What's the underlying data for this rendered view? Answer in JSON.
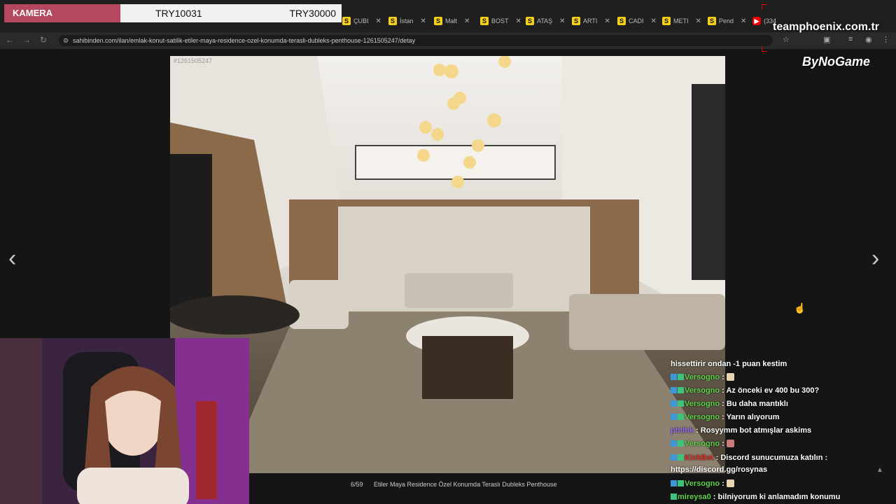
{
  "overlay": {
    "kamera_label": "KAMERA",
    "try_current": "TRY10031",
    "try_target": "TRY30000",
    "brand_url": "teamphoenix.com.tr",
    "brand_logo": "ByNoGame"
  },
  "browser": {
    "tabs": [
      {
        "label": "ÇUBI",
        "favicon": "S"
      },
      {
        "label": "İstan",
        "favicon": "S"
      },
      {
        "label": "Malt",
        "favicon": "S"
      },
      {
        "label": "BOST",
        "favicon": "S"
      },
      {
        "label": "ATAŞ",
        "favicon": "S"
      },
      {
        "label": "ARTI",
        "favicon": "S"
      },
      {
        "label": "CADI",
        "favicon": "S"
      },
      {
        "label": "METI",
        "favicon": "S"
      },
      {
        "label": "Pend",
        "favicon": "S"
      },
      {
        "label": "(334",
        "favicon": "yt"
      }
    ],
    "url": "sahibinden.com/ilan/emlak-konut-satilik-etiler-maya-residence-ozel-konumda-terasli-dubleks-penthouse-1261505247/detay"
  },
  "listing": {
    "ad_id": "#1261505247",
    "photo_counter": "6/59",
    "title": "Etiler Maya Residence Özel Konumda Teraslı Dubleks Penthouse",
    "prev_arrow": "‹",
    "next_arrow": "›"
  },
  "chat": {
    "messages": [
      {
        "user": "",
        "text": "hissettirir ondan -1 puan kestim",
        "style": "none"
      },
      {
        "user": "Versogno",
        "text": " : ",
        "emote": true,
        "style": "green"
      },
      {
        "user": "Versogno",
        "text": " : Az önceki ev 400 bu 300?",
        "style": "green"
      },
      {
        "user": "Versogno",
        "text": " : Bu daha mantıklı",
        "style": "green"
      },
      {
        "user": "Versogno",
        "text": " : Yarın alıyorum",
        "style": "green"
      },
      {
        "user": "pbtihk",
        "text": " : Rosyymm bot atmışlar askims",
        "style": "purple"
      },
      {
        "user": "Versogno",
        "text": " : ",
        "emote": true,
        "emote_style": "fig",
        "style": "green"
      },
      {
        "user": "KickBot",
        "text": " : Discord sunucumuza katılın :",
        "style": "red"
      },
      {
        "user": "",
        "text": "https://discord.gg/rosynas",
        "style": "none"
      },
      {
        "user": "Versogno",
        "text": " : ",
        "emote": true,
        "style": "green"
      },
      {
        "user": "mireysa0",
        "text": " : bilniyorum ki anlamadım konumu",
        "style": "green"
      }
    ]
  },
  "colors": {
    "kamera_bg": "#b5475f",
    "chat_green": "#5fd34a",
    "favicon_yellow": "#f5d018"
  }
}
